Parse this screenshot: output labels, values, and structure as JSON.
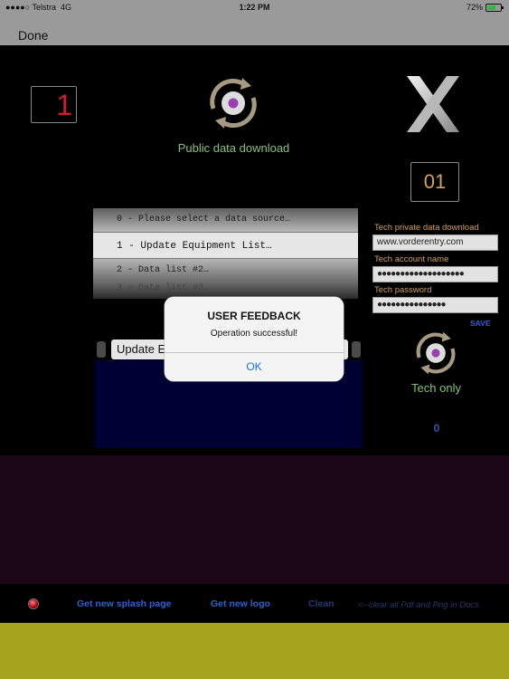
{
  "status_bar": {
    "carrier": "●●●●○ Telstra",
    "network": "4G",
    "time": "1:22 PM",
    "battery_percent": "72%",
    "battery_level": 0.72
  },
  "nav": {
    "done_label": "Done"
  },
  "page_number": "1",
  "counter": "01",
  "public_download_label": "Public data download",
  "picker": {
    "rows": [
      "0 - Please select a data source…",
      "1 - Update Equipment List…",
      "2 - Data list #2…",
      "3 - Data list #3…"
    ],
    "selected_index": 1
  },
  "tech": {
    "private_download_label": "Tech private data download",
    "url_value": "www.vorderentry.com",
    "account_label": "Tech account name",
    "account_value": "●●●●●●●●●●●●●●●●●●●",
    "password_label": "Tech password",
    "password_value": "●●●●●●●●●●●●●●●",
    "save_label": "SAVE",
    "tech_only_label": "Tech only",
    "zero_label": "0"
  },
  "selector": {
    "value": "Update Equipment List"
  },
  "alert": {
    "title": "USER FEEDBACK",
    "message": "Operation successful!",
    "ok_label": "OK"
  },
  "toolbar": {
    "splash_label": "Get new splash page",
    "logo_label": "Get new logo",
    "clean_label": "Clean",
    "clean_note": "<--clear all Pdf and Png in Docs"
  },
  "colors": {
    "background": "#000000",
    "green_label": "#86c07a",
    "gold_label": "#d4a05a",
    "link_blue": "#2d64c8",
    "navy_panel": "#000033",
    "purple_panel": "#1b0715",
    "olive_panel": "#a4a31b",
    "page_number_red": "#d01c2a"
  },
  "icons": {
    "sync": "sync-arrows-icon",
    "logo": "x-logo-icon",
    "battery": "battery-icon",
    "record": "red-record-icon"
  }
}
